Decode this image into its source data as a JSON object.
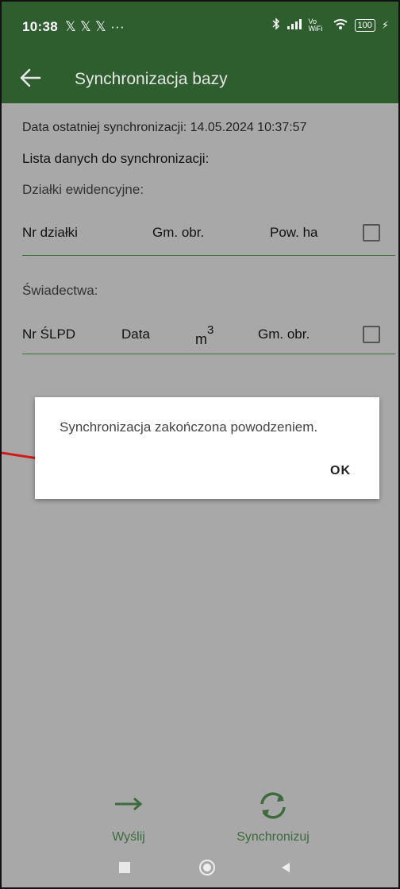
{
  "status_bar": {
    "time": "10:38",
    "app_icons": "𝕏 𝕏 𝕏 ···",
    "right_text": "Vo WiFi",
    "battery": "100"
  },
  "app_bar": {
    "title": "Synchronizacja bazy",
    "back_icon": "arrow-left-icon"
  },
  "content": {
    "last_sync": "Data ostatniej synchronizacji: 14.05.2024 10:37:57",
    "list_title": "Lista danych do synchronizacji:",
    "parcels": {
      "section_label": "Działki ewidencyjne:",
      "columns": [
        "Nr działki",
        "Gm. obr.",
        "Pow. ha"
      ]
    },
    "certificates": {
      "section_label": "Świadectwa:",
      "columns": [
        "Nr ŚLPD",
        "Data",
        "m",
        "Gm. obr."
      ],
      "superscript": "3"
    }
  },
  "dialog": {
    "message": "Synchronizacja zakończona powodzeniem.",
    "ok_label": "OK"
  },
  "bottom": {
    "send_label": "Wyślij",
    "sync_label": "Synchronizuj"
  },
  "colors": {
    "app_bar": "#2e5e2e",
    "overlay_bg": "#a8a8a8",
    "accent_green": "#3d6b3d",
    "pointer_red": "#d11a1a"
  }
}
